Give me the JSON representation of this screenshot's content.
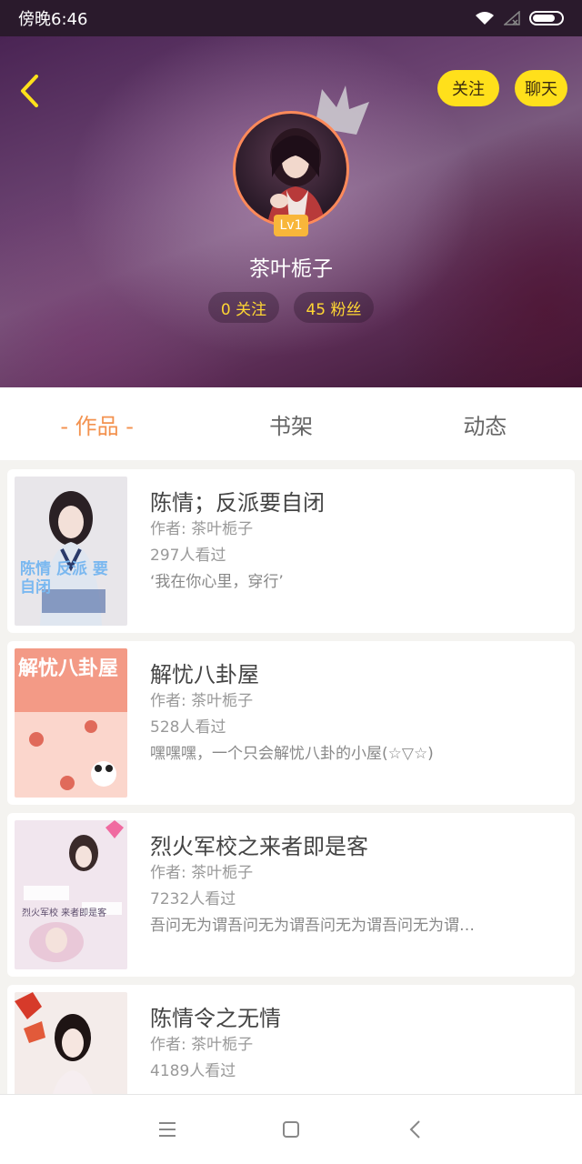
{
  "status_bar": {
    "time": "傍晚6:46"
  },
  "header": {
    "follow_button": "关注",
    "chat_button": "聊天",
    "level": "Lv1",
    "username": "茶叶栀子",
    "following": "0 关注",
    "fans": "45 粉丝"
  },
  "tabs": [
    {
      "label": "- 作品 -"
    },
    {
      "label": "书架"
    },
    {
      "label": "动态"
    }
  ],
  "books": [
    {
      "title": "陈情；反派要自闭",
      "author": "作者: 茶叶栀子",
      "views": "297人看过",
      "desc": "‘我在你心里，穿行’",
      "cover_text": "陈情 反派 要自闭"
    },
    {
      "title": "解忧八卦屋",
      "author": "作者: 茶叶栀子",
      "views": "528人看过",
      "desc": "嘿嘿嘿，一个只会解忧八卦的小屋(☆▽☆)",
      "cover_text": "解忧八卦屋"
    },
    {
      "title": "烈火军校之来者即是客",
      "author": "作者: 茶叶栀子",
      "views": "7232人看过",
      "desc": "吾问无为谓吾问无为谓吾问无为谓吾问无为谓…",
      "cover_text": "烈火军校 来者即是客"
    },
    {
      "title": "陈情令之无情",
      "author": "作者: 茶叶栀子",
      "views": "4189人看过",
      "desc": ""
    }
  ],
  "colors": {
    "accent": "#f3924f",
    "pill_yellow": "#ffe01b",
    "badge": "#f8b63a"
  }
}
